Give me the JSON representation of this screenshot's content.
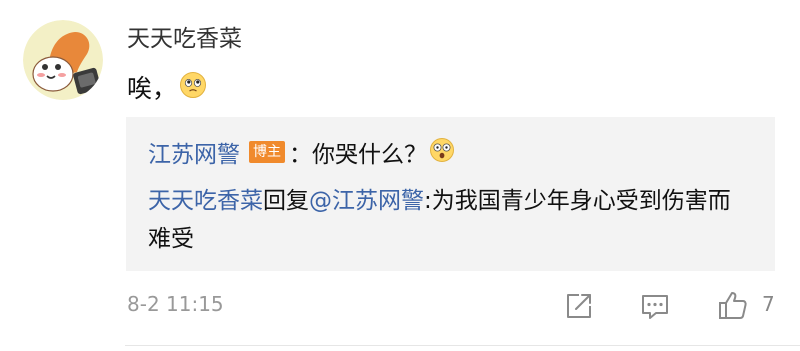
{
  "comment": {
    "username": "天天吃香菜",
    "text": "唉，",
    "timestamp": "8-2 11:15",
    "like_count": "7",
    "avatar_icon": "cartoon-character-avatar",
    "emoji_icon": "sad-face-emoji"
  },
  "reply": {
    "author": "江苏网警",
    "author_badge": "博主",
    "author_text": "：你哭什么？",
    "author_emoji_icon": "surprised-face-emoji",
    "replier": "天天吃香菜",
    "reply_word": "回复",
    "mention": "@江苏网警",
    "reply_text": ":为我国青少年身心受到伤害而难受"
  },
  "actions": {
    "share_icon": "share-icon",
    "comment_icon": "comment-icon",
    "like_icon": "thumbs-up-icon"
  },
  "colors": {
    "link_blue": "#3c64a8",
    "badge_orange": "#f08a2c",
    "reply_bg": "#f3f3f3",
    "meta_gray": "#999999"
  }
}
